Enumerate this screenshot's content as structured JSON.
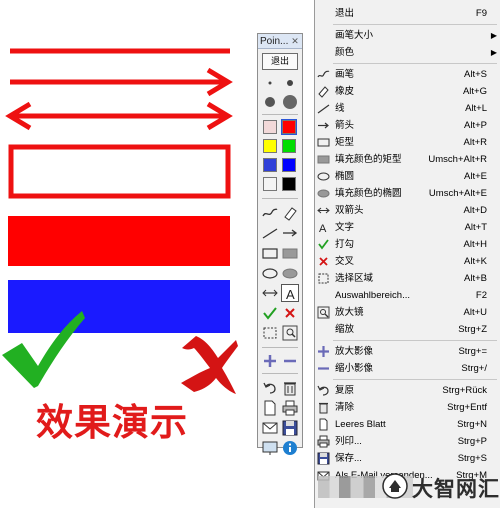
{
  "canvas": {
    "caption": "效果演示"
  },
  "toolbar": {
    "title": "Poin...",
    "close": "✕",
    "exit_label": "退出",
    "palette": [
      "#f2d9d9",
      "#ff0000",
      "#ffff00",
      "#00dd00",
      "#2f3fd8",
      "#0000ff",
      "#f4f4f4",
      "#000000"
    ]
  },
  "menu": {
    "items": [
      {
        "label": "退出",
        "shortcut": "F9",
        "icon": ""
      },
      {
        "label": "画笔大小",
        "shortcut": "",
        "icon": "",
        "submenu": true
      },
      {
        "label": "颜色",
        "shortcut": "",
        "icon": "",
        "submenu": true
      },
      {
        "label": "画笔",
        "shortcut": "Alt+S",
        "icon": "pen-icon"
      },
      {
        "label": "橡皮",
        "shortcut": "Alt+G",
        "icon": "eraser-icon"
      },
      {
        "label": "线",
        "shortcut": "Alt+L",
        "icon": "line-icon"
      },
      {
        "label": "箭头",
        "shortcut": "Alt+P",
        "icon": "arrow-icon"
      },
      {
        "label": "矩型",
        "shortcut": "Alt+R",
        "icon": "rectangle-icon"
      },
      {
        "label": "填充颜色的矩型",
        "shortcut": "Umsch+Alt+R",
        "icon": "filled-rectangle-icon"
      },
      {
        "label": "椭圆",
        "shortcut": "Alt+E",
        "icon": "ellipse-icon"
      },
      {
        "label": "填充颜色的椭圆",
        "shortcut": "Umsch+Alt+E",
        "icon": "filled-ellipse-icon"
      },
      {
        "label": "双箭头",
        "shortcut": "Alt+D",
        "icon": "double-arrow-icon"
      },
      {
        "label": "文字",
        "shortcut": "Alt+T",
        "icon": "text-icon"
      },
      {
        "label": "打勾",
        "shortcut": "Alt+H",
        "icon": "checkmark-icon"
      },
      {
        "label": "交叉",
        "shortcut": "Alt+K",
        "icon": "cross-icon"
      },
      {
        "label": "选择区域",
        "shortcut": "Alt+B",
        "icon": "selection-icon"
      },
      {
        "label": "Auswahlbereich...",
        "shortcut": "F2",
        "icon": ""
      },
      {
        "label": "放大镜",
        "shortcut": "Alt+U",
        "icon": "magnifier-icon"
      },
      {
        "label": "缩放",
        "shortcut": "Strg+Z",
        "icon": ""
      },
      {
        "label": "放大影像",
        "shortcut": "Strg+=",
        "icon": "zoom-in-icon"
      },
      {
        "label": "缩小影像",
        "shortcut": "Strg+/",
        "icon": "zoom-out-icon"
      },
      {
        "label": "复原",
        "shortcut": "Strg+Rück",
        "icon": "undo-icon"
      },
      {
        "label": "清除",
        "shortcut": "Strg+Entf",
        "icon": "trash-icon"
      },
      {
        "label": "Leeres Blatt",
        "shortcut": "Strg+N",
        "icon": "blank-page-icon"
      },
      {
        "label": "列印...",
        "shortcut": "Strg+P",
        "icon": "print-icon"
      },
      {
        "label": "保存...",
        "shortcut": "Strg+S",
        "icon": "save-icon"
      },
      {
        "label": "Als E-Mail versenden...",
        "shortcut": "Strg+M",
        "icon": "email-icon"
      }
    ]
  },
  "watermark": {
    "text": "大智网汇"
  },
  "colors": {
    "drawing_red": "#ee1111",
    "drawing_blue": "#1a1aff",
    "check_green": "#22b022",
    "cross_red": "#d41414"
  }
}
